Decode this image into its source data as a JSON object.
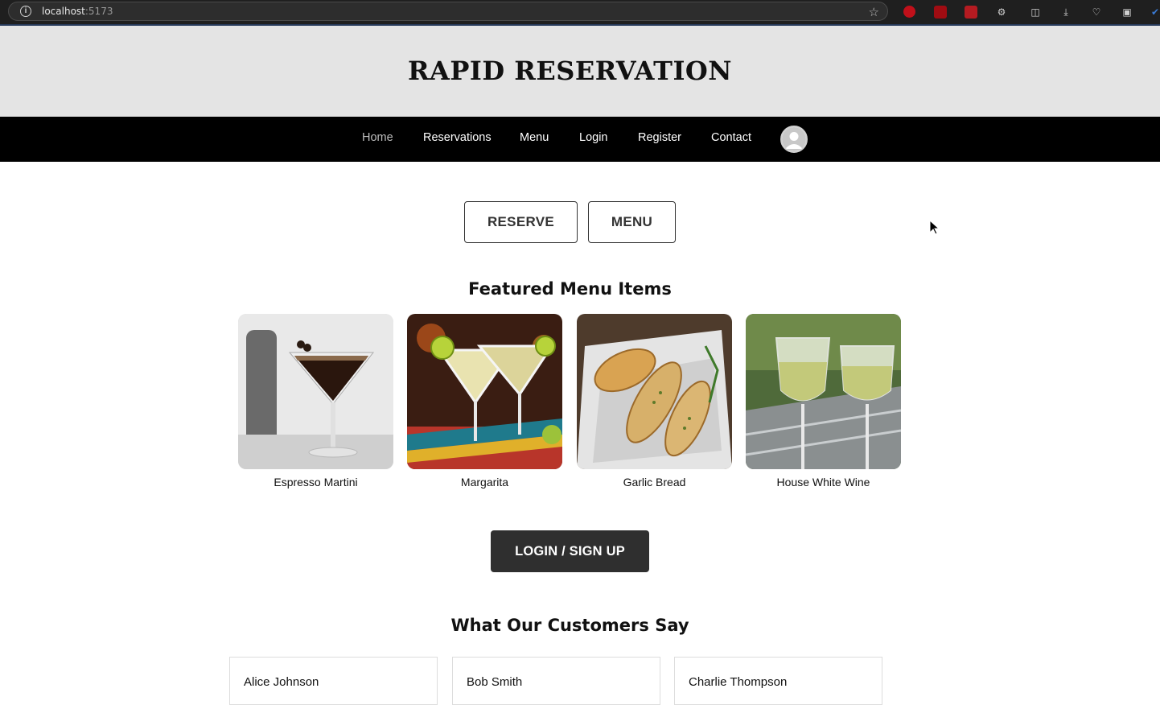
{
  "browser": {
    "url_host": "localhost",
    "url_port": ":5173"
  },
  "site": {
    "title": "RAPID RESERVATION"
  },
  "nav": {
    "items": [
      "Home",
      "Reservations",
      "Menu",
      "Login",
      "Register",
      "Contact"
    ],
    "active": "Home"
  },
  "hero": {
    "reserve_label": "RESERVE",
    "menu_label": "MENU"
  },
  "featured": {
    "heading": "Featured Menu Items",
    "items": [
      {
        "name": "Espresso Martini"
      },
      {
        "name": "Margarita"
      },
      {
        "name": "Garlic Bread"
      },
      {
        "name": "House White Wine"
      }
    ]
  },
  "cta": {
    "login_label": "LOGIN / SIGN UP"
  },
  "testimonials": {
    "heading": "What Our Customers Say",
    "customers": [
      "Alice Johnson",
      "Bob Smith",
      "Charlie Thompson"
    ]
  },
  "colors": {
    "header_bg": "#e4e4e4",
    "nav_bg": "#000000",
    "cta_bg": "#2f2f2f"
  }
}
